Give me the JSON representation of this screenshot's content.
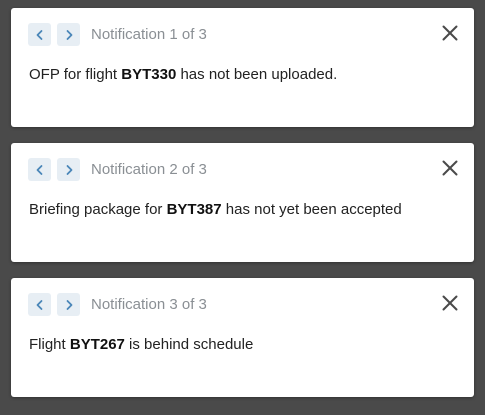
{
  "colors": {
    "backdrop": "#4a4a4a",
    "card": "#ffffff",
    "nav_button_bg": "#e7eef4",
    "nav_arrow": "#4a86b8",
    "counter_text": "#8a8f94",
    "close_icon": "#4a4a4a"
  },
  "icons": {
    "prev": "chevron-left-icon",
    "next": "chevron-right-icon",
    "close": "close-icon"
  },
  "notifications": [
    {
      "counter": "Notification 1 of 3",
      "message_before": "OFP for flight ",
      "flight": "BYT330",
      "message_after": " has not been uploaded."
    },
    {
      "counter": "Notification 2 of 3",
      "message_before": "Briefing package for ",
      "flight": "BYT387",
      "message_after": " has not yet been accepted"
    },
    {
      "counter": "Notification 3 of 3",
      "message_before": "Flight ",
      "flight": "BYT267",
      "message_after": " is behind schedule"
    }
  ]
}
